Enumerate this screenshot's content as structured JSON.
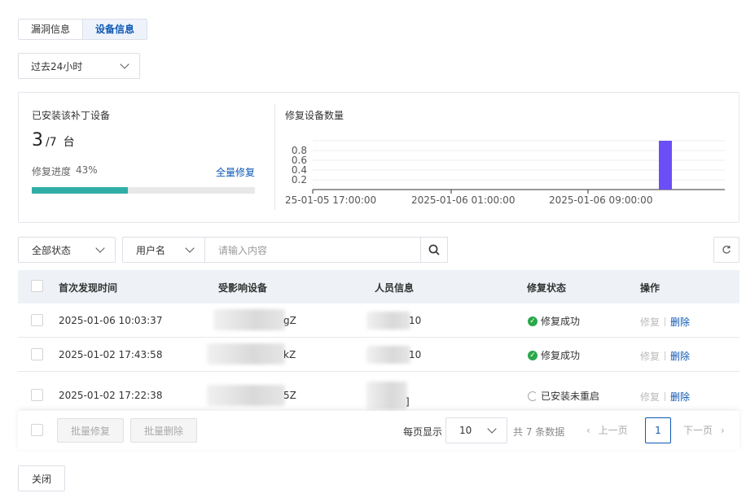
{
  "tabs": [
    {
      "label": "漏洞信息"
    },
    {
      "label": "设备信息"
    }
  ],
  "time_range": {
    "value": "过去24小时"
  },
  "summary": {
    "title": "已安装该补丁设备",
    "installed": "3",
    "total": "/7",
    "unit": "台",
    "progress_label": "修复进度",
    "progress_value": "43%",
    "progress_fraction": 0.43,
    "fix_all_label": "全量修复"
  },
  "chart": {
    "title": "修复设备数量",
    "chart_data": {
      "type": "bar",
      "title": "修复设备数量",
      "x_ticks": [
        "25-01-05 17:00:00",
        "2025-01-06 01:00:00",
        "2025-01-06 09:00:00"
      ],
      "y_ticks": [
        "0.8",
        "0.6",
        "0.4",
        "0.2"
      ],
      "ylim": [
        0,
        1
      ],
      "series": [
        {
          "x": "2025-01-06 10:00:00",
          "value": 1
        }
      ],
      "color": "#6b4ef5"
    }
  },
  "filters": {
    "status_select": "全部状态",
    "field_select": "用户名",
    "search_placeholder": "请输入内容"
  },
  "table": {
    "columns": [
      "首次发现时间",
      "受影响设备",
      "人员信息",
      "修复状态",
      "操作"
    ],
    "rows": [
      {
        "time": "2025-01-06 10:03:37",
        "device_tail": "gZ",
        "person_tail": "10",
        "status": "修复成功",
        "status_type": "success"
      },
      {
        "time": "2025-01-02 17:43:58",
        "device_tail": "kZ",
        "person_tail": "10",
        "status": "修复成功",
        "status_type": "success"
      },
      {
        "time": "2025-01-02 17:22:38",
        "device_tail": "5Z",
        "person_tail": "]",
        "status": "已安装未重启",
        "status_type": "pending"
      }
    ],
    "action_fix": "修复",
    "action_delete": "删除"
  },
  "footer": {
    "batch_fix": "批量修复",
    "batch_delete": "批量删除",
    "page_size_label": "每页显示",
    "page_size": "10",
    "total_text": "共 7 条数据",
    "prev": "上一页",
    "current_page": "1",
    "next": "下一页"
  },
  "close_label": "关闭"
}
